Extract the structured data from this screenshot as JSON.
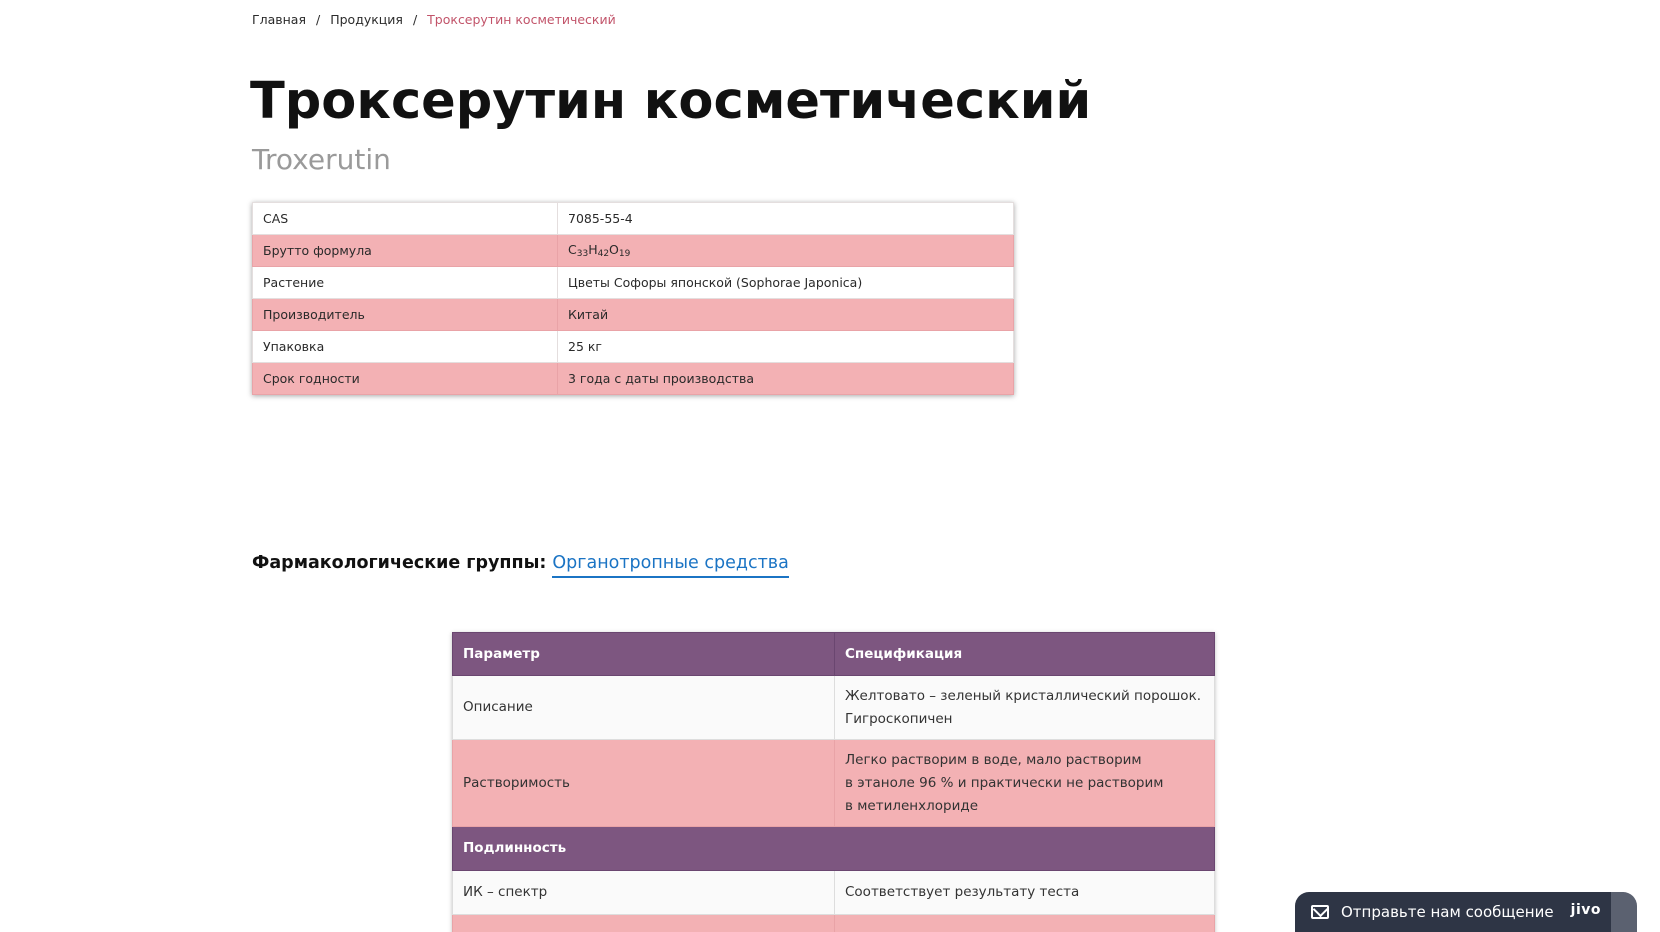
{
  "breadcrumb": {
    "home": "Главная",
    "products": "Продукция",
    "current": "Троксерутин косметический",
    "separator": "/"
  },
  "title": "Троксерутин косметический",
  "subtitle": "Troxerutin",
  "properties": [
    {
      "key": "CAS",
      "value": "7085-55-4"
    },
    {
      "key": "Брутто формула",
      "value_parts": [
        "C",
        "33",
        "H",
        "42",
        "O",
        "19"
      ]
    },
    {
      "key": "Растение",
      "value": "Цветы Софоры японской (Sophorae Japonica)"
    },
    {
      "key": "Производитель",
      "value": "Китай"
    },
    {
      "key": "Упаковка",
      "value": "25 кг"
    },
    {
      "key": "Срок годности",
      "value": "3 года с даты производства"
    }
  ],
  "pharm_groups": {
    "label": "Фармакологические группы:",
    "link": "Органотропные средства"
  },
  "spec_table": {
    "headers": [
      "Параметр",
      "Спецификация"
    ],
    "rows": [
      {
        "param": "Описание",
        "spec_lines": [
          "Желтовато – зеленый кристаллический порошок.",
          "Гигроскопичен"
        ]
      },
      {
        "param": "Растворимость",
        "spec_lines": [
          "Легко растворим в воде, мало растворим",
          "в этаноле 96 % и практически не растворим",
          "в метиленхлориде"
        ]
      }
    ],
    "section": "Подлинность",
    "section_rows": [
      {
        "param": "ИК – спектр",
        "spec": "Соответствует результату теста"
      }
    ]
  },
  "chat": {
    "label": "Отправьте нам сообщение",
    "brand": "jivo"
  },
  "colors": {
    "accent_pink": "#f3b1b4",
    "header_purple": "#7d5680",
    "link_blue": "#1b74c4",
    "breadcrumb_current": "#c2546a",
    "chat_bg": "#2e3545"
  }
}
